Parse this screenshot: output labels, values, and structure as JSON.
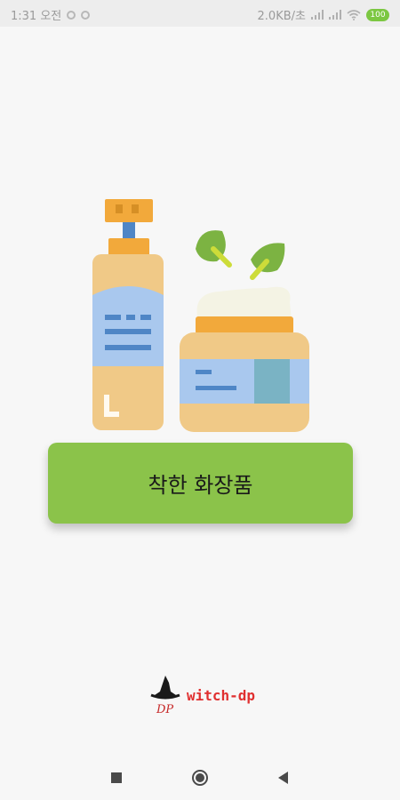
{
  "status_bar": {
    "time": "1:31 오전",
    "network_speed": "2.0KB/초",
    "battery": "100"
  },
  "main": {
    "title_button_label": "착한 화장품",
    "illustration_icon": "cosmetics-bottle-and-jar-icon"
  },
  "brand": {
    "name": "witch-dp",
    "logo_text": "DP",
    "logo_icon": "witch-hat-icon"
  },
  "nav": {
    "recent_icon": "square-icon",
    "home_icon": "circle-icon",
    "back_icon": "triangle-back-icon"
  },
  "colors": {
    "button": "#8bc34a",
    "brand_text": "#e03030",
    "bottle_body": "#f0c987",
    "label": "#a9c8ee",
    "cap": "#f2a93b",
    "leaf": "#7cb342"
  }
}
